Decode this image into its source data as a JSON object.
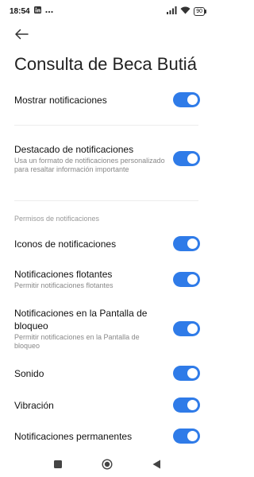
{
  "status_bar": {
    "time": "18:54",
    "battery": "90",
    "icons": [
      "linkedin-icon",
      "more-icon",
      "signal-icon",
      "wifi-icon",
      "battery-icon"
    ]
  },
  "page": {
    "title": "Consulta de Beca Butiá"
  },
  "settings": {
    "show_notifications": {
      "label": "Mostrar notificaciones",
      "enabled": true
    },
    "highlighted": {
      "label": "Destacado de notificaciones",
      "description": "Usa un formato de notificaciones personalizado para resaltar información importante",
      "enabled": true
    },
    "section_header": "Permisos de notificaciones",
    "notification_icons": {
      "label": "Iconos de notificaciones",
      "enabled": true
    },
    "floating": {
      "label": "Notificaciones flotantes",
      "description": "Permitir notificaciones flotantes",
      "enabled": true
    },
    "lock_screen": {
      "label": "Notificaciones en la Pantalla de bloqueo",
      "description": "Permitir notificaciones en la Pantalla de bloqueo",
      "enabled": true
    },
    "sound": {
      "label": "Sonido",
      "enabled": true
    },
    "vibration": {
      "label": "Vibración",
      "enabled": true
    },
    "persistent": {
      "label": "Notificaciones permanentes",
      "enabled": true
    }
  },
  "colors": {
    "accent": "#2f7be8",
    "text": "#111111",
    "secondary_text": "#888888"
  },
  "nav_bar": {
    "icons": [
      "recents-icon",
      "home-icon",
      "back-nav-icon"
    ]
  }
}
